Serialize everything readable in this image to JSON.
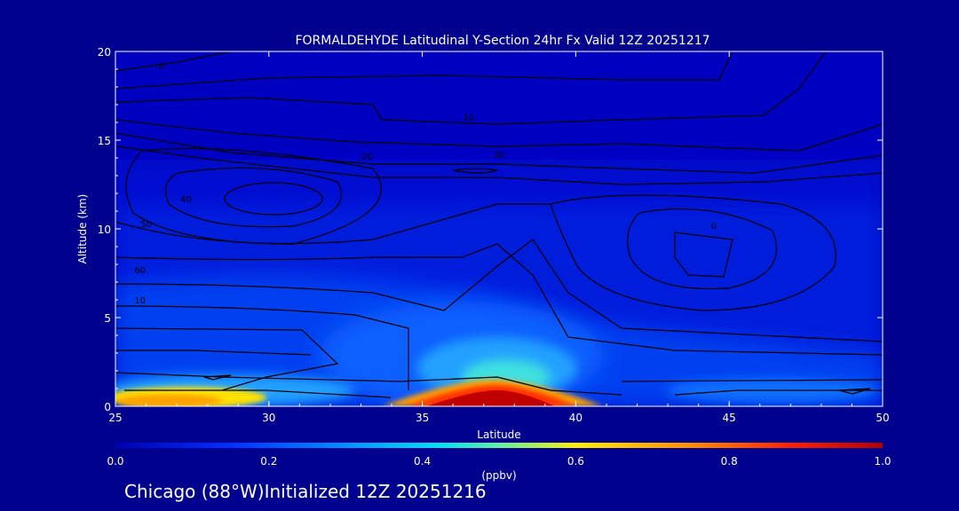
{
  "chart_data": {
    "type": "heatmap",
    "title": "FORMALDEHYDE Latitudinal Y-Section 24hr  Fx Valid 12Z 20251217",
    "xlabel": "Latitude",
    "ylabel": "Altitude (km)",
    "xlim": [
      25,
      50
    ],
    "ylim": [
      0,
      20
    ],
    "x_ticks": [
      "25",
      "30",
      "35",
      "40",
      "45",
      "50"
    ],
    "y_ticks": [
      "0",
      "5",
      "10",
      "15",
      "20"
    ],
    "colorbar": {
      "label": "(ppbv)",
      "range": [
        0.0,
        1.0
      ],
      "ticks": [
        "0.0",
        "0.2",
        "0.4",
        "0.6",
        "0.8",
        "1.0"
      ],
      "colors": [
        "#0000b4",
        "#0050ff",
        "#00c8ff",
        "#ffe600",
        "#ff5000",
        "#b40000"
      ]
    },
    "field_features": [
      {
        "lat": 37.5,
        "alt": 0.5,
        "value": 1.0
      },
      {
        "lat": 26.5,
        "alt": 0.2,
        "value": 0.8
      },
      {
        "lat": 37.0,
        "alt": 2.0,
        "value": 0.5
      },
      {
        "lat": 36.5,
        "alt": 4.0,
        "value": 0.3
      },
      {
        "lat": 44.0,
        "alt": 1.0,
        "value": 0.25
      }
    ],
    "contour_labels": [
      "0",
      "10",
      "20",
      "30",
      "40",
      "50",
      "60",
      "10",
      "0"
    ],
    "grid": false
  },
  "footer": "Chicago (88°W)Initialized 12Z 20251216"
}
